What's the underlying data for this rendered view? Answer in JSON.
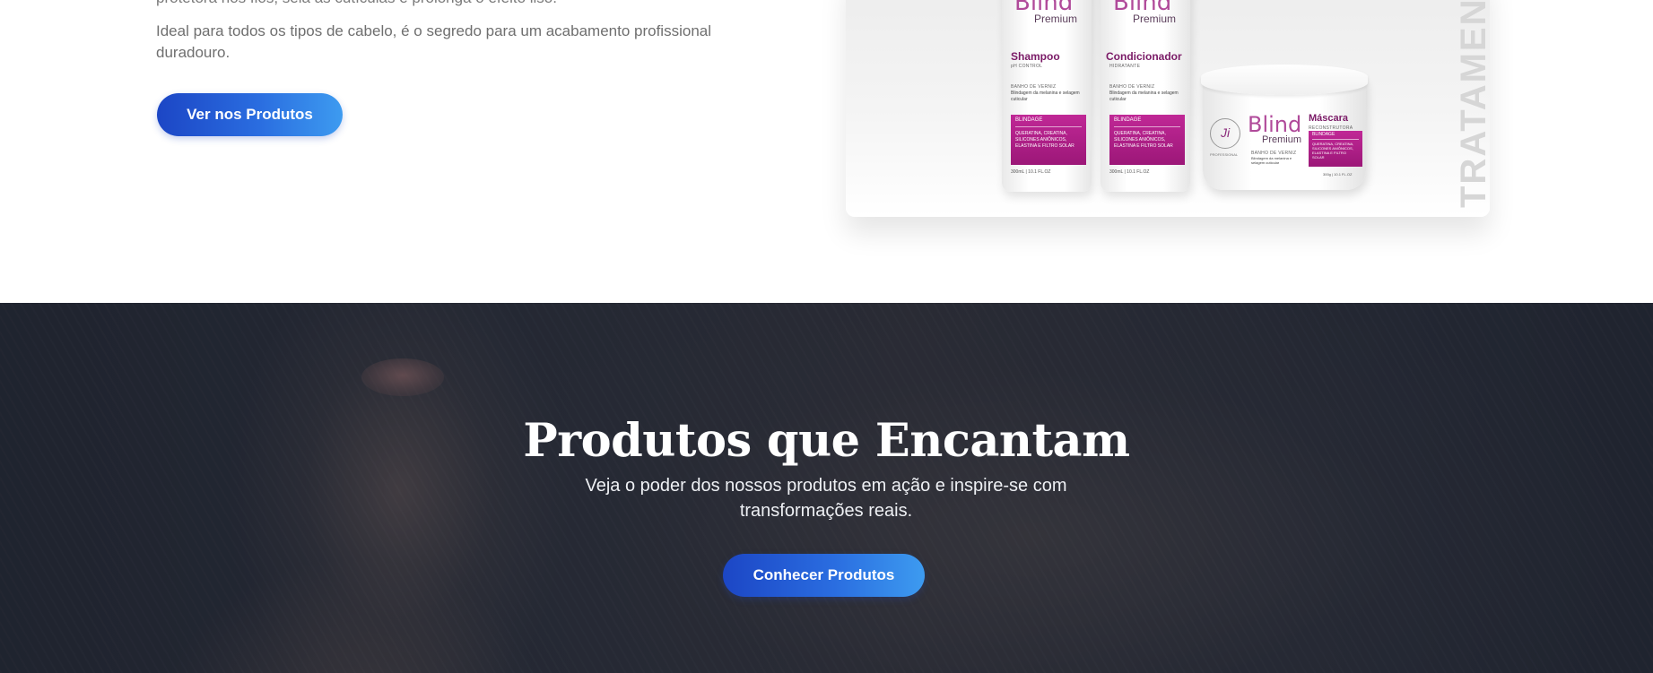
{
  "intro": {
    "cut_line": "protetora nos fios, sela as cutículas e prolonga o efeito liso.",
    "paragraph": "Ideal para todos os tipos de cabelo, é o segredo para um acabamento profissional duradouro.",
    "button_label": "Ver nos Produtos"
  },
  "product_image": {
    "vertical_word": "TRATAMENTO",
    "brand": "Blind",
    "brand_sub": "Premium",
    "items": [
      {
        "name": "Shampoo",
        "subtitle": "pH CONTROL",
        "kicker": "BANHO DE VERNIZ",
        "desc": "Blindagem da melanina e selagem cuticular",
        "label_head": "BLINDAGE",
        "label_body": "QUERATINA, CREATINA, SILICONES ANIÔNICOS, ELASTINA E FILTRO SOLAR",
        "volume": "300mL | 10.1 FL.OZ"
      },
      {
        "name": "Condicionador",
        "subtitle": "HIDRATANTE",
        "kicker": "BANHO DE VERNIZ",
        "desc": "Blindagem da melanina e selagem cuticular",
        "label_head": "BLINDAGE",
        "label_body": "QUERATINA, CREATINA, SILICONES ANIÔNICOS, ELASTINA E FILTRO SOLAR",
        "volume": "300mL | 10.1 FL.OZ"
      },
      {
        "name": "Máscara",
        "subtitle": "RECONSTRUTORA",
        "kicker": "BANHO DE VERNIZ",
        "desc": "Blindagem da melanina e selagem cuticular",
        "label_head": "BLINDAGE",
        "label_body": "QUERATINA, CREATINA, SILICONES ANIÔNICOS, ELASTINA E FILTRO SOLAR",
        "volume": "300g | 10.1 FL.OZ",
        "logo_caption": "PROFESSIONAL"
      }
    ]
  },
  "hero": {
    "title": "Produtos que Encantam",
    "subtitle": "Veja o poder dos nossos produtos em ação e inspire-se com transformações reais.",
    "button_label": "Conhecer Produtos"
  },
  "colors": {
    "button_gradient_start": "#1c46c5",
    "button_gradient_end": "#3d9bf0",
    "hero_background": "#2b303b",
    "label_magenta": "#b0238a"
  }
}
